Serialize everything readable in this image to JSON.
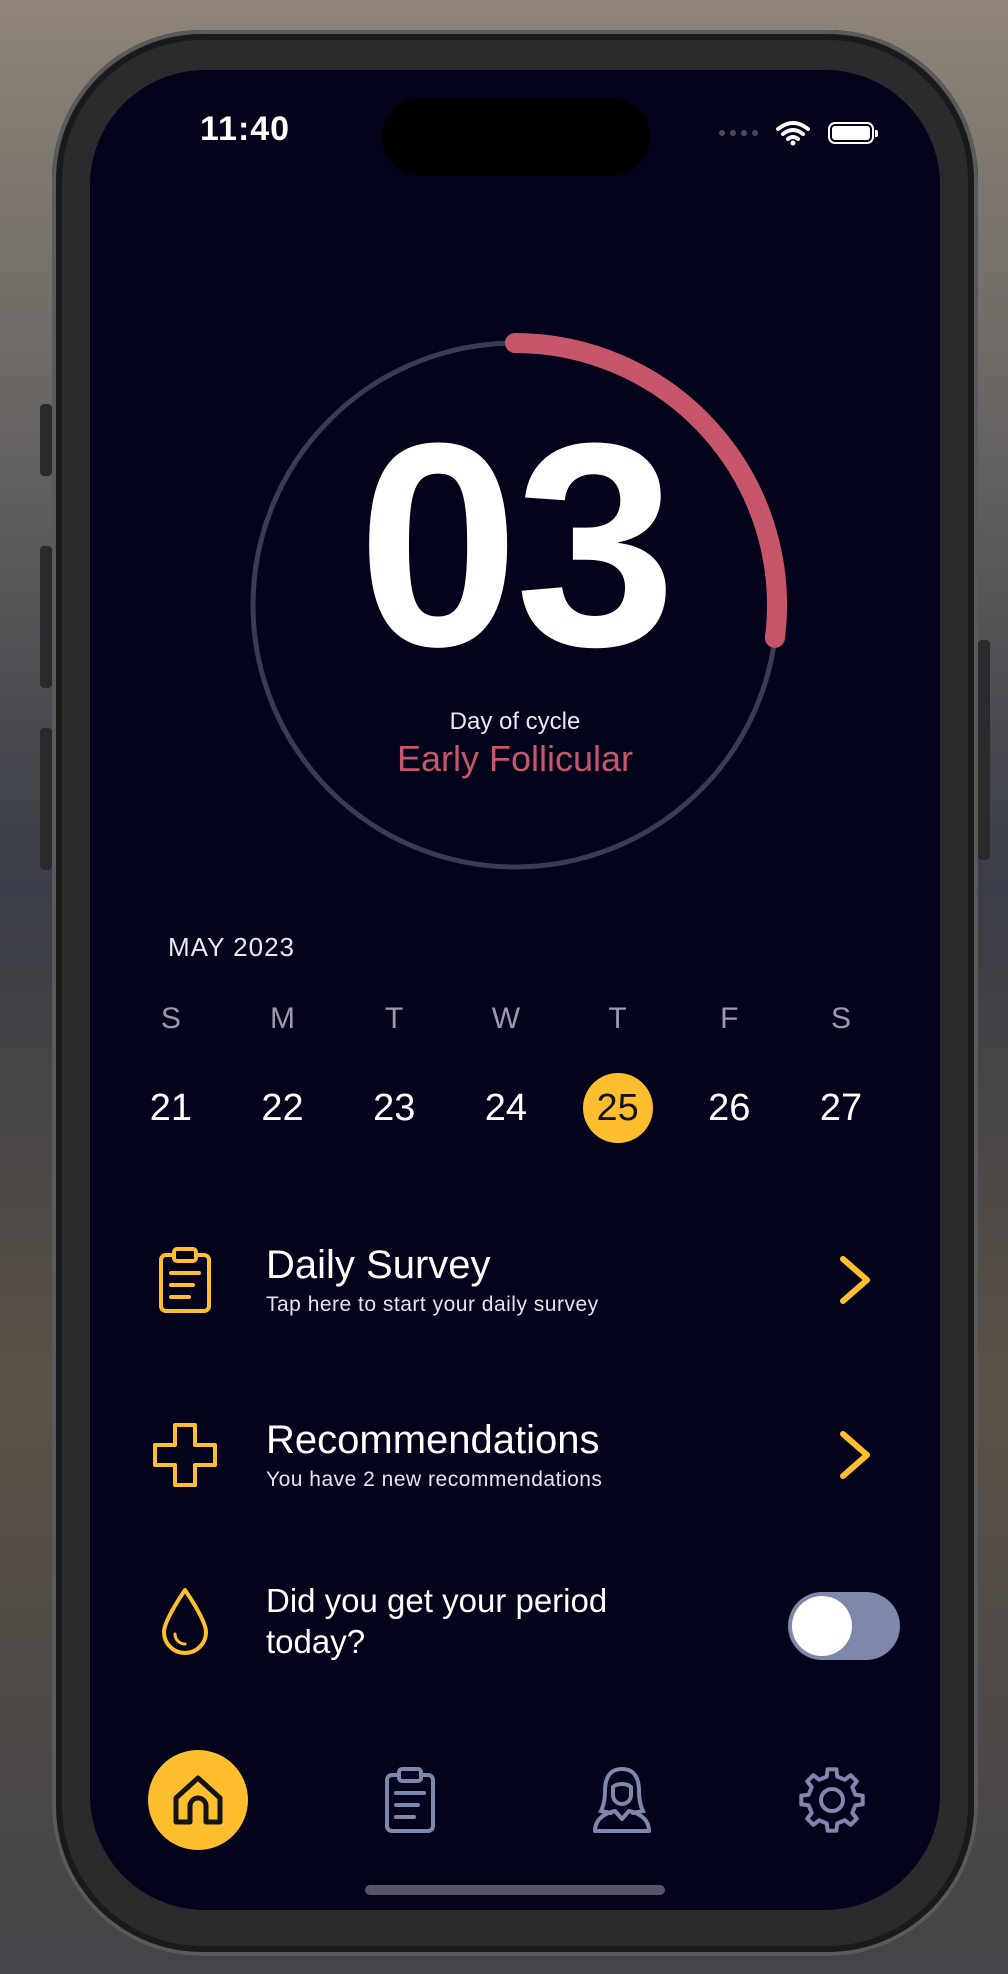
{
  "status_bar": {
    "time": "11:40"
  },
  "cycle": {
    "day_number": "03",
    "day_label": "Day of cycle",
    "phase": "Early Follicular",
    "progress_fraction": 0.27,
    "ring_color": "#c8566b"
  },
  "calendar": {
    "month": "MAY 2023",
    "weekdays": [
      "S",
      "M",
      "T",
      "W",
      "T",
      "F",
      "S"
    ],
    "dates": [
      "21",
      "22",
      "23",
      "24",
      "25",
      "26",
      "27"
    ],
    "selected_date": "25",
    "highlight_color": "#ffbe2e"
  },
  "daily_survey": {
    "title": "Daily Survey",
    "subtitle": "Tap here to start your daily survey",
    "icon": "clipboard-icon"
  },
  "recommendations": {
    "title": "Recommendations",
    "subtitle": "You have 2 new recommendations",
    "icon": "medical-cross-icon"
  },
  "period": {
    "question_line1": "Did you get your period",
    "question_line2": "today?",
    "toggle_on": false,
    "icon": "drop-icon"
  },
  "tabbar": {
    "tabs": [
      {
        "name": "home",
        "icon": "home-icon",
        "active": true
      },
      {
        "name": "survey",
        "icon": "clipboard-icon",
        "active": false
      },
      {
        "name": "profile",
        "icon": "woman-icon",
        "active": false
      },
      {
        "name": "settings",
        "icon": "gear-icon",
        "active": false
      }
    ]
  },
  "colors": {
    "background": "#03031c",
    "accent": "#ffbe2e",
    "tab_inactive": "#7f87aa"
  }
}
